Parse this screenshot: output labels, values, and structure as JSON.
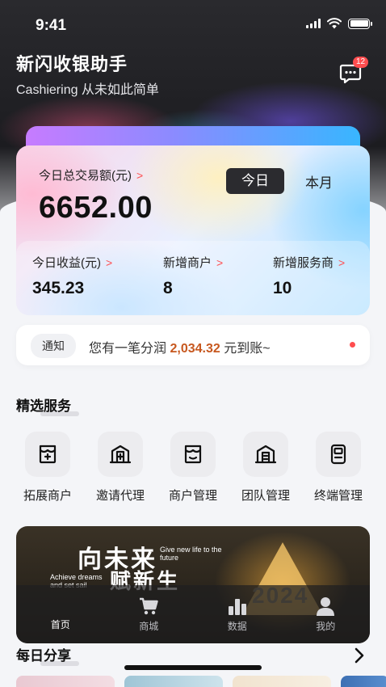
{
  "status_bar": {
    "time": "9:41"
  },
  "header": {
    "title": "新闪收银助手",
    "subtitle": "Cashiering 从未如此简单",
    "message_badge": "12"
  },
  "summary_card": {
    "total_label": "今日总交易额(元)",
    "total_value": "6652.00",
    "period_tabs": [
      {
        "label": "今日",
        "active": true
      },
      {
        "label": "本月",
        "active": false
      }
    ],
    "stats": [
      {
        "label": "今日收益(元)",
        "value": "345.23"
      },
      {
        "label": "新增商户",
        "value": "8"
      },
      {
        "label": "新增服务商",
        "value": "10"
      }
    ]
  },
  "notice": {
    "tag": "通知",
    "text_before": "您有一笔分润",
    "amount": "2,034.32",
    "text_after": "元到账~"
  },
  "services": {
    "title": "精选服务",
    "items": [
      {
        "label": "拓展商户",
        "icon": "store-plus-icon"
      },
      {
        "label": "邀请代理",
        "icon": "building-plus-icon"
      },
      {
        "label": "商户管理",
        "icon": "store-face-icon"
      },
      {
        "label": "团队管理",
        "icon": "building-team-icon"
      },
      {
        "label": "终端管理",
        "icon": "pos-terminal-icon"
      }
    ]
  },
  "banner": {
    "title_line1": "向未来",
    "title_line2": "赋新生",
    "en_line1": "Give new life to the future",
    "en_line2": "Achieve dreams and set sail",
    "year": "2024"
  },
  "tabbar": {
    "items": [
      {
        "label": "首页",
        "icon": "home-icon",
        "active": true
      },
      {
        "label": "商城",
        "icon": "cart-icon",
        "active": false
      },
      {
        "label": "数据",
        "icon": "bar-chart-icon",
        "active": false
      },
      {
        "label": "我的",
        "icon": "user-icon",
        "active": false
      }
    ]
  },
  "daily_share": {
    "title": "每日分享"
  },
  "colors": {
    "accent": "#ff4d4f",
    "amount": "#c7581f",
    "dark": "#2b2b2f"
  }
}
